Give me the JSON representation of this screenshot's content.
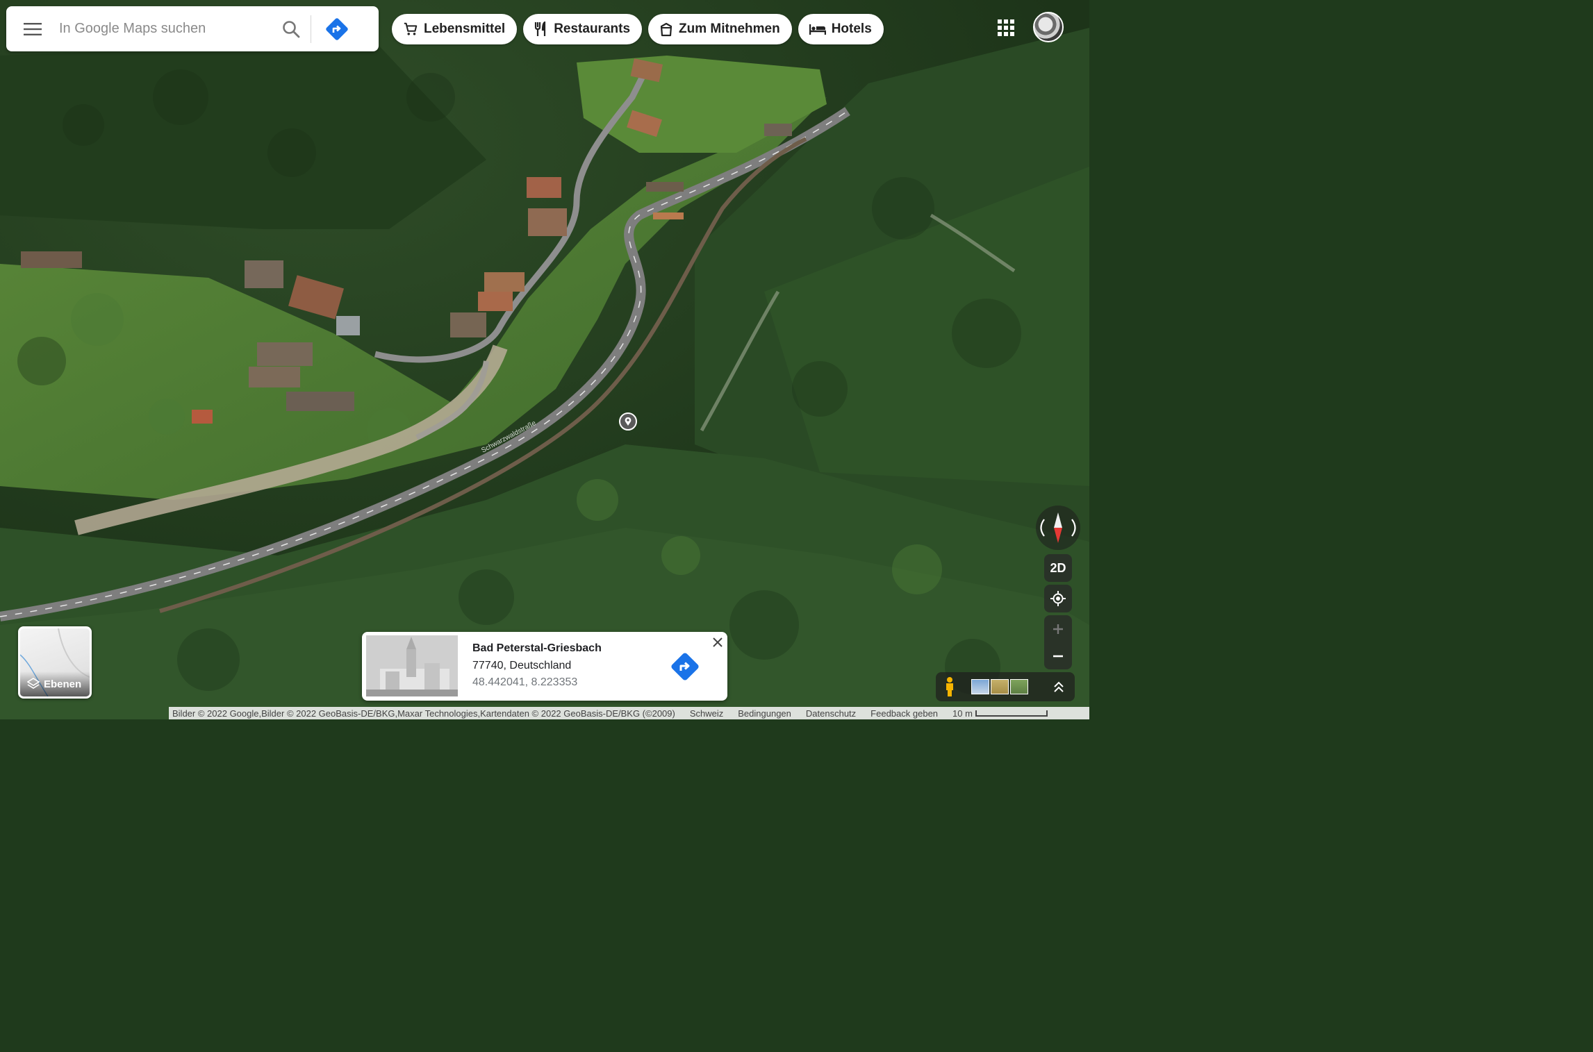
{
  "search": {
    "placeholder": "In Google Maps suchen"
  },
  "chips": [
    {
      "label": "Lebensmittel",
      "icon": "cart-icon"
    },
    {
      "label": "Restaurants",
      "icon": "cutlery-icon"
    },
    {
      "label": "Zum Mitnehmen",
      "icon": "takeout-icon"
    },
    {
      "label": "Hotels",
      "icon": "bed-icon"
    }
  ],
  "layers": {
    "label": "Ebenen"
  },
  "place": {
    "title": "Bad Peterstal-Griesbach",
    "address": "77740, Deutschland",
    "coords": "48.442041, 8.223353"
  },
  "road_label": "Schwarzwaldstraße",
  "view_toggle": "2D",
  "footer": {
    "attribution": "Bilder © 2022 Google,Bilder © 2022 GeoBasis-DE/BKG,Maxar Technologies,Kartendaten © 2022 GeoBasis-DE/BKG (©2009)",
    "links": [
      "Schweiz",
      "Bedingungen",
      "Datenschutz",
      "Feedback geben"
    ],
    "scale": "10 m"
  },
  "colors": {
    "accent": "#1a73e8",
    "forest": "#2c4a25",
    "meadow": "#5f8a3e",
    "road": "#8c8c8c",
    "roof": "#9a6b4a"
  }
}
